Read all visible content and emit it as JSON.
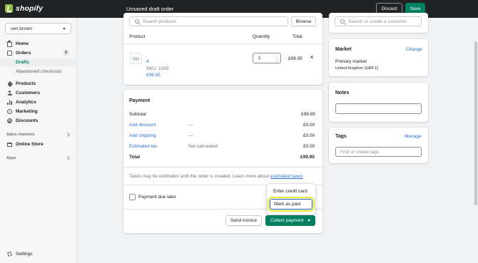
{
  "topbar": {
    "brand": "shopify",
    "title": "Unsaved draft order",
    "discard_label": "Discard",
    "save_label": "Save"
  },
  "sidebar": {
    "store_name": "ceri.brown",
    "items": [
      {
        "label": "Home",
        "icon": "home-icon"
      },
      {
        "label": "Orders",
        "icon": "orders-icon",
        "badge": "8"
      },
      {
        "label": "Drafts",
        "active": true
      },
      {
        "label": "Abandoned checkouts"
      },
      {
        "label": "Products",
        "icon": "tag-icon"
      },
      {
        "label": "Customers",
        "icon": "person-icon"
      },
      {
        "label": "Analytics",
        "icon": "bar-chart-icon"
      },
      {
        "label": "Marketing",
        "icon": "target-icon"
      },
      {
        "label": "Discounts",
        "icon": "discount-icon"
      }
    ],
    "sales_channels_label": "Sales channels",
    "online_store_label": "Online Store",
    "apps_label": "Apps",
    "settings_label": "Settings"
  },
  "products_card": {
    "search_placeholder": "Search products",
    "browse_label": "Browse",
    "col_product": "Product",
    "col_quantity": "Quantity",
    "col_total": "Total",
    "line_item": {
      "name": "4",
      "sku": "SKU: 1000",
      "price": "£99.95",
      "quantity": "1",
      "total": "£99.95"
    }
  },
  "payment_card": {
    "title": "Payment",
    "subtotal_label": "Subtotal",
    "subtotal_value": "£99.95",
    "discount_label": "Add discount",
    "discount_mid": "—",
    "discount_value": "£0.00",
    "shipping_label": "Add shipping",
    "shipping_mid": "—",
    "shipping_value": "£0.00",
    "tax_label": "Estimated tax",
    "tax_mid": "Not calculated",
    "tax_value": "£0.00",
    "total_label": "Total",
    "total_value": "£99.95",
    "note_prefix": "Taxes may be estimates until the order is created. Learn more about ",
    "note_link": "estimated taxes",
    "due_later_label": "Payment due later",
    "send_invoice_label": "Send invoice",
    "collect_payment_label": "Collect payment",
    "menu": [
      "Enter credit card",
      "Mark as paid"
    ]
  },
  "customer_card": {
    "search_placeholder": "Search or create a customer"
  },
  "market_card": {
    "title": "Market",
    "change_label": "Change",
    "market_name": "Primary market",
    "market_detail": "United Kingdom (GBP £)"
  },
  "notes_card": {
    "title": "Notes"
  },
  "tags_card": {
    "title": "Tags",
    "manage_label": "Manage",
    "placeholder": "Find or create tags"
  }
}
